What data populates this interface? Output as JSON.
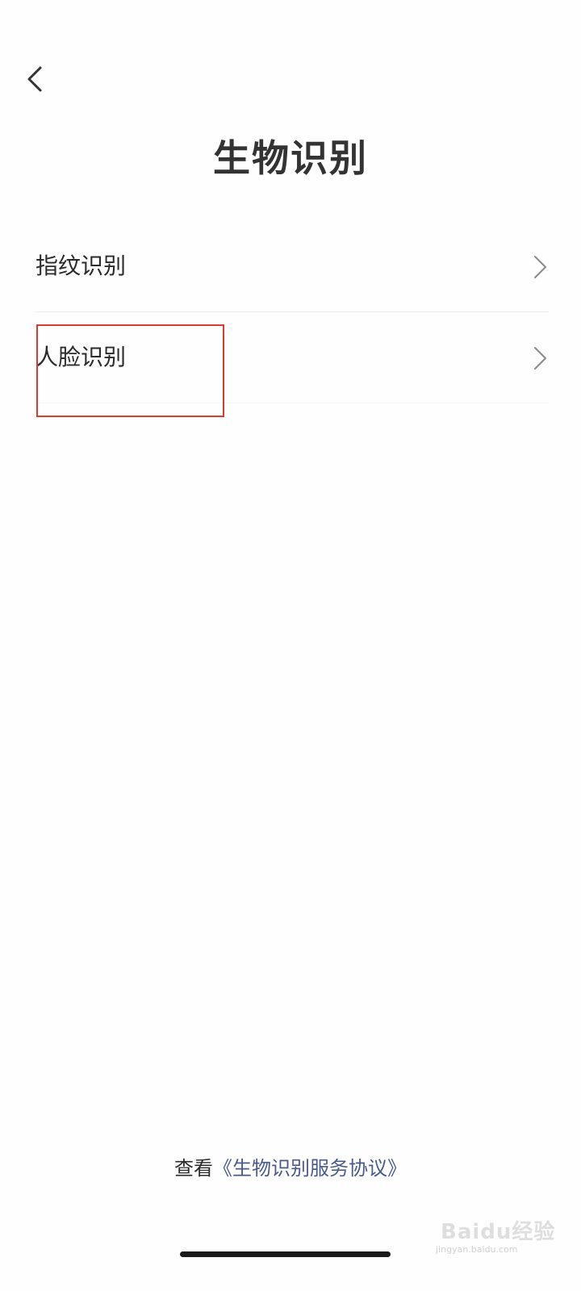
{
  "header": {
    "back_icon": "chevron-left-icon",
    "title": "生物识别"
  },
  "menu": {
    "items": [
      {
        "label": "指纹识别",
        "icon": "chevron-right-icon"
      },
      {
        "label": "人脸识别",
        "icon": "chevron-right-icon",
        "highlighted": true
      }
    ]
  },
  "footer": {
    "prefix": "查看",
    "agreement": "《生物识别服务协议》"
  },
  "watermark": {
    "main": "Baidu经验",
    "sub": "jingyan.baidu.com"
  },
  "colors": {
    "highlight": "#e03a2f",
    "link": "#4a5a8c",
    "text": "#2b2b2b"
  }
}
